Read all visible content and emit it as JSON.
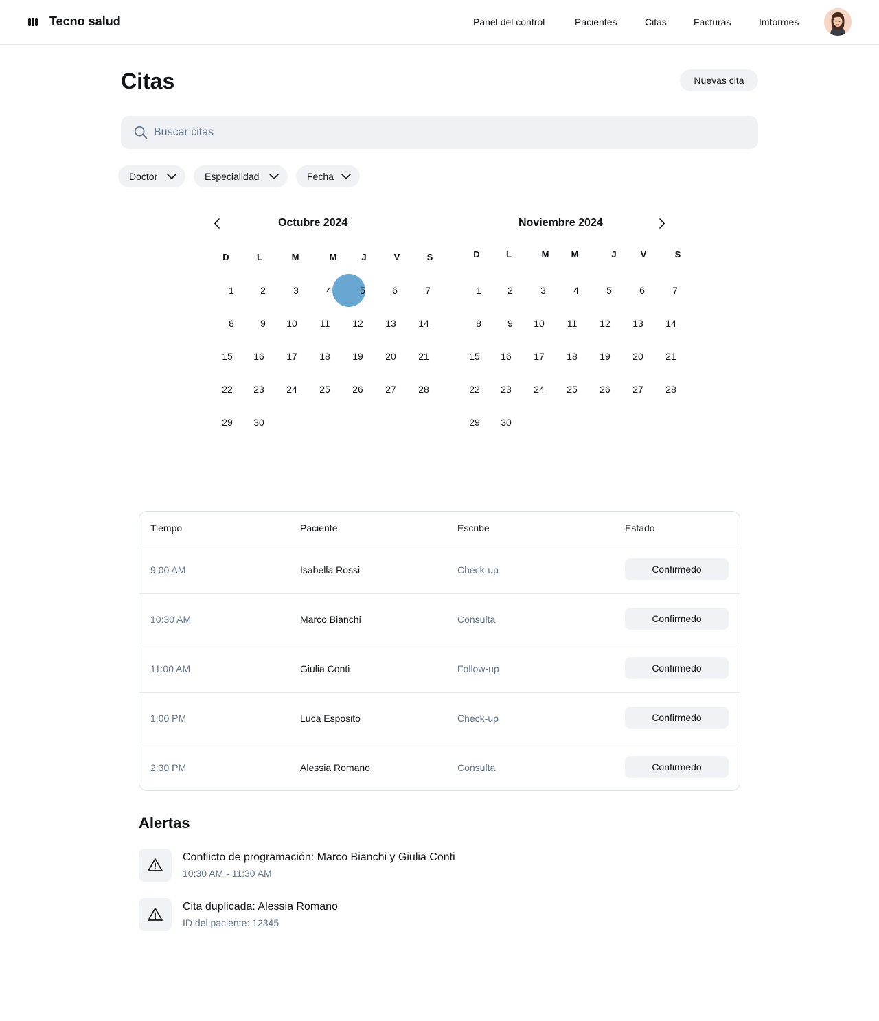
{
  "header": {
    "brand": "Tecno salud",
    "nav": [
      "Panel del control",
      "Pacientes",
      "Citas",
      "Facturas",
      "Imformes"
    ]
  },
  "page": {
    "title": "Citas",
    "new_button": "Nuevas cita"
  },
  "search": {
    "placeholder": "Buscar citas",
    "value": ""
  },
  "filters": [
    "Doctor",
    "Especialidad",
    "Fecha"
  ],
  "calendars": [
    {
      "title": "Octubre 2024",
      "weekdays": [
        "D",
        "L",
        "M",
        "M",
        "J",
        "V",
        "S"
      ],
      "days": [
        "1",
        "2",
        "3",
        "4",
        "5",
        "6",
        "7",
        "8",
        "9",
        "10",
        "11",
        "12",
        "13",
        "14",
        "15",
        "16",
        "17",
        "18",
        "19",
        "20",
        "21",
        "22",
        "23",
        "24",
        "25",
        "26",
        "27",
        "28",
        "29",
        "30"
      ],
      "selected_day": "5"
    },
    {
      "title": "Noviembre 2024",
      "weekdays": [
        "D",
        "L",
        "M",
        "M",
        "J",
        "V",
        "S"
      ],
      "days": [
        "1",
        "2",
        "3",
        "4",
        "5",
        "6",
        "7",
        "8",
        "9",
        "10",
        "11",
        "12",
        "13",
        "14",
        "15",
        "16",
        "17",
        "18",
        "19",
        "20",
        "21",
        "22",
        "23",
        "24",
        "25",
        "26",
        "27",
        "28",
        "29",
        "30"
      ]
    }
  ],
  "table": {
    "headers": [
      "Tiempo",
      "Paciente",
      "Escribe",
      "Estado"
    ],
    "rows": [
      {
        "time": "9:00 AM",
        "patient": "Isabella Rossi",
        "type": "Check-up",
        "status": "Confirmedo"
      },
      {
        "time": "10:30 AM",
        "patient": "Marco Bianchi",
        "type": "Consulta",
        "status": "Confirmedo"
      },
      {
        "time": "11:00 AM",
        "patient": "Giulia Conti",
        "type": "Follow-up",
        "status": "Confirmedo"
      },
      {
        "time": "1:00 PM",
        "patient": "Luca Esposito",
        "type": "Check-up",
        "status": "Confirmedo"
      },
      {
        "time": "2:30 PM",
        "patient": "Alessia Romano",
        "type": "Consulta",
        "status": "Confirmedo"
      }
    ]
  },
  "alerts": {
    "title": "Alertas",
    "items": [
      {
        "icon": "warning-icon",
        "title": "Conflicto de programación: Marco Bianchi y Giulia Conti",
        "subtitle": "10:30 AM - 11:30 AM"
      },
      {
        "icon": "warning-icon",
        "title": "Cita duplicada: Alessia Romano",
        "subtitle": "ID del paciente: 12345"
      }
    ]
  },
  "colors": {
    "accent_selected_day": "#5a9fcd",
    "muted_text": "#61758a",
    "chip_bg": "#f0f2f5"
  }
}
